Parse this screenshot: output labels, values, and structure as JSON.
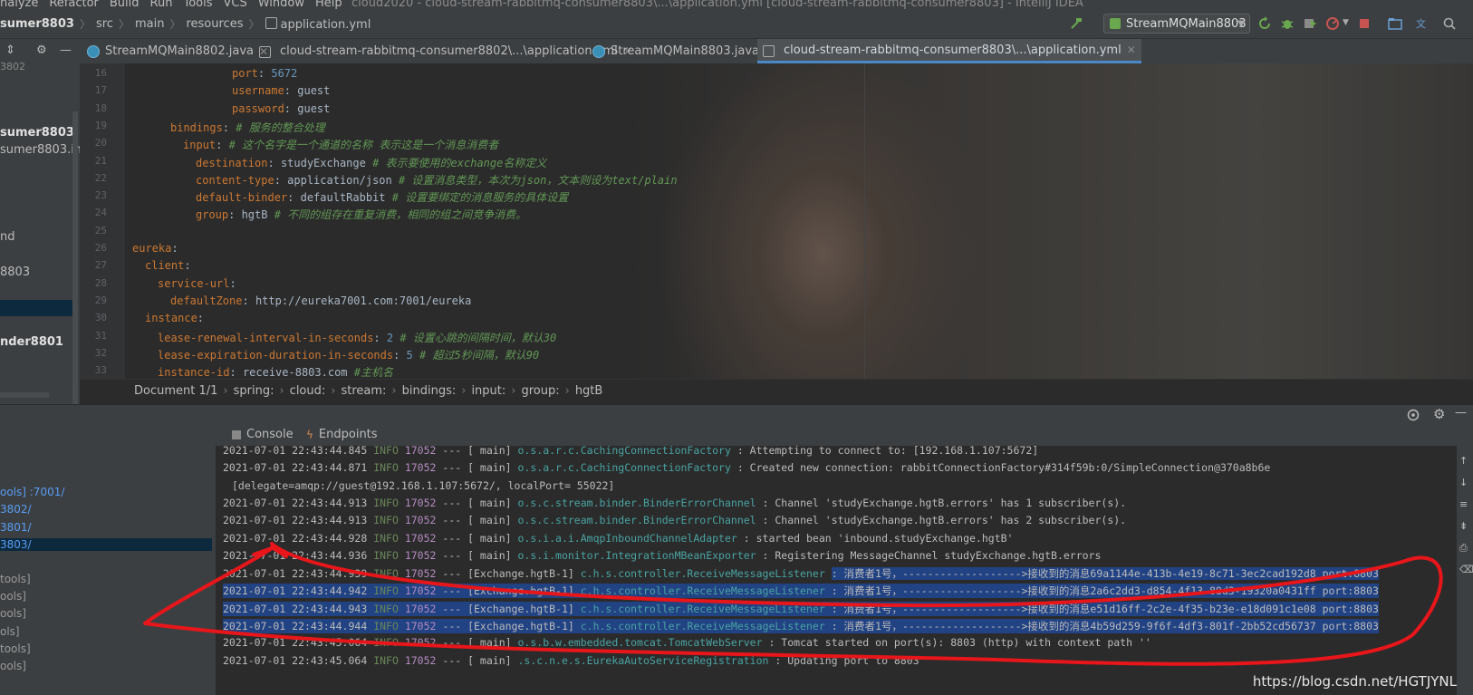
{
  "menu": [
    "nalyze",
    "Refactor",
    "Build",
    "Run",
    "Tools",
    "VCS",
    "Window",
    "Help"
  ],
  "window_title": "cloud2020 - cloud-stream-rabbitmq-consumer8803\\...\\application.yml [cloud-stream-rabbitmq-consumer8803] - IntelliJ IDEA",
  "navbar": {
    "project": "sumer8803",
    "path": [
      "src",
      "main",
      "resources"
    ],
    "file": "application.yml",
    "run_config": "StreamMQMain8803"
  },
  "project_panel": {
    "items": [
      "3802",
      "sumer8803",
      "sumer8803.iml",
      "nd",
      "8803",
      "nder8801"
    ]
  },
  "tabs": [
    {
      "label": "StreamMQMain8802.java"
    },
    {
      "label": "cloud-stream-rabbitmq-consumer8802\\...\\application.yml"
    },
    {
      "label": "StreamMQMain8803.java"
    },
    {
      "label": "cloud-stream-rabbitmq-consumer8803\\...\\application.yml"
    }
  ],
  "editor": {
    "lines": [
      {
        "num": "16",
        "key": "port",
        "val": "5672",
        "comment": ""
      },
      {
        "num": "17",
        "key": "username",
        "val": "guest",
        "comment": ""
      },
      {
        "num": "18",
        "key": "password",
        "val": "guest",
        "comment": ""
      },
      {
        "num": "19",
        "key": "bindings",
        "val": "",
        "comment": "# 服务的整合处理"
      },
      {
        "num": "20",
        "key": "input",
        "val": "",
        "comment": "# 这个名字是一个通道的名称  表示这是一个消息消费者"
      },
      {
        "num": "21",
        "key": "destination",
        "val": "studyExchange",
        "comment": "# 表示要使用的exchange名称定义"
      },
      {
        "num": "22",
        "key": "content-type",
        "val": "application/json",
        "comment": "# 设置消息类型，本次为json，文本则设为text/plain"
      },
      {
        "num": "23",
        "key": "default-binder",
        "val": "defaultRabbit",
        "comment": "# 设置要绑定的消息服务的具体设置"
      },
      {
        "num": "24",
        "key": "group",
        "val": "hgtB",
        "comment": "# 不同的组存在重复消费，相同的组之间竞争消费。"
      },
      {
        "num": "25",
        "key": "",
        "val": "",
        "comment": ""
      },
      {
        "num": "26",
        "key": "eureka",
        "val": "",
        "comment": ""
      },
      {
        "num": "27",
        "key": "client",
        "val": "",
        "comment": ""
      },
      {
        "num": "28",
        "key": "service-url",
        "val": "",
        "comment": ""
      },
      {
        "num": "29",
        "key": "defaultZone",
        "val": "http://eureka7001.com:7001/eureka",
        "comment": ""
      },
      {
        "num": "30",
        "key": "instance",
        "val": "",
        "comment": ""
      },
      {
        "num": "31",
        "key": "lease-renewal-interval-in-seconds",
        "val": "2",
        "comment": "# 设置心跳的间隔时间，默认30"
      },
      {
        "num": "32",
        "key": "lease-expiration-duration-in-seconds",
        "val": "5",
        "comment": "# 超过5秒间隔，默认90"
      },
      {
        "num": "33",
        "key": "instance-id",
        "val": "receive-8803.com",
        "comment": "#主机名"
      }
    ]
  },
  "breadcrumb": [
    "Document 1/1",
    "spring:",
    "cloud:",
    "stream:",
    "bindings:",
    "input:",
    "group:",
    "hgtB"
  ],
  "run_tabs": [
    "Console",
    "Endpoints"
  ],
  "services": [
    {
      "text": "ools] :7001/",
      "link": true
    },
    {
      "text": "3802/",
      "link": true
    },
    {
      "text": "3801/",
      "link": true
    },
    {
      "text": "3803/",
      "link": true
    },
    {
      "text": "tools]",
      "link": false
    },
    {
      "text": "ools]",
      "link": false
    },
    {
      "text": "ools]",
      "link": false
    },
    {
      "text": "ols]",
      "link": false
    },
    {
      "text": "tools]",
      "link": false
    },
    {
      "text": "ools]",
      "link": false
    }
  ],
  "console": {
    "lines": [
      {
        "ts": "2021-07-01 22:43:44.845",
        "lvl": "INFO",
        "pid": "17052",
        "thr": "---  [           main]",
        "logger": "o.s.a.r.c.CachingConnectionFactory      ",
        "msg": ": Attempting to connect to: [192.168.1.107:5672]"
      },
      {
        "ts": "2021-07-01 22:43:44.871",
        "lvl": "INFO",
        "pid": "17052",
        "thr": "---  [           main]",
        "logger": "o.s.a.r.c.CachingConnectionFactory      ",
        "msg": ": Created new connection: rabbitConnectionFactory#314f59b:0/SimpleConnection@370a8b6e"
      },
      {
        "ts": "",
        "lvl": "",
        "pid": "",
        "thr": "[delegate=amqp://guest@192.168.1.107:5672/, localPort= 55022]",
        "logger": "",
        "msg": ""
      },
      {
        "ts": "2021-07-01 22:43:44.913",
        "lvl": "INFO",
        "pid": "17052",
        "thr": "---  [           main]",
        "logger": "o.s.c.stream.binder.BinderErrorChannel   ",
        "msg": ": Channel 'studyExchange.hgtB.errors' has 1 subscriber(s)."
      },
      {
        "ts": "2021-07-01 22:43:44.913",
        "lvl": "INFO",
        "pid": "17052",
        "thr": "---  [           main]",
        "logger": "o.s.c.stream.binder.BinderErrorChannel   ",
        "msg": ": Channel 'studyExchange.hgtB.errors' has 2 subscriber(s)."
      },
      {
        "ts": "2021-07-01 22:43:44.928",
        "lvl": "INFO",
        "pid": "17052",
        "thr": "---  [           main]",
        "logger": "o.s.i.a.i.AmqpInboundChannelAdapter      ",
        "msg": ": started bean 'inbound.studyExchange.hgtB'"
      },
      {
        "ts": "2021-07-01 22:43:44.936",
        "lvl": "INFO",
        "pid": "17052",
        "thr": "---  [           main]",
        "logger": "o.s.i.monitor.IntegrationMBeanExporter   ",
        "msg": ": Registering MessageChannel studyExchange.hgtB.errors"
      },
      {
        "ts": "2021-07-01 22:43:44.939",
        "lvl": "INFO",
        "pid": "17052",
        "thr": "---  [Exchange.hgtB-1]",
        "logger": "c.h.s.controller.ReceiveMessageListener  ",
        "msg": ": 消费者1号，------------------->接收到的消息69a1144e-413b-4e19-8c71-3ec2cad192d8     port:8803"
      },
      {
        "ts": "2021-07-01 22:43:44.942",
        "lvl": "INFO",
        "pid": "17052",
        "thr": "---  [Exchange.hgtB-1]",
        "logger": "c.h.s.controller.ReceiveMessageListener  ",
        "msg": ": 消费者1号，------------------->接收到的消息2a6c2dd3-d854-4f13-88d3-19320a0431ff     port:8803"
      },
      {
        "ts": "2021-07-01 22:43:44.943",
        "lvl": "INFO",
        "pid": "17052",
        "thr": "---  [Exchange.hgtB-1]",
        "logger": "c.h.s.controller.ReceiveMessageListener  ",
        "msg": ": 消费者1号，------------------->接收到的消息e51d16ff-2c2e-4f35-b23e-e18d091c1e08     port:8803"
      },
      {
        "ts": "2021-07-01 22:43:44.944",
        "lvl": "INFO",
        "pid": "17052",
        "thr": "---  [Exchange.hgtB-1]",
        "logger": "c.h.s.controller.ReceiveMessageListener  ",
        "msg": ": 消费者1号，------------------->接收到的消息4b59d259-9f6f-4df3-801f-2bb52cd56737     port:8803"
      },
      {
        "ts": "2021-07-01 22:43:45.064",
        "lvl": "INFO",
        "pid": "17052",
        "thr": "---  [           main]",
        "logger": "o.s.b.w.embedded.tomcat.TomcatWebServer  ",
        "msg": ": Tomcat started on port(s): 8803 (http) with context path ''"
      },
      {
        "ts": "2021-07-01 22:43:45.064",
        "lvl": "INFO",
        "pid": "17052",
        "thr": "---  [           main]",
        "logger": ".s.c.n.e.s.EurekaAutoServiceRegistration ",
        "msg": ": Updating port to 8803"
      }
    ]
  },
  "watermark": "https://blog.csdn.net/HGTJYNL",
  "colors": {
    "accent": "#4a88c7",
    "annotation": "#e8161a",
    "selection": "#214283"
  }
}
